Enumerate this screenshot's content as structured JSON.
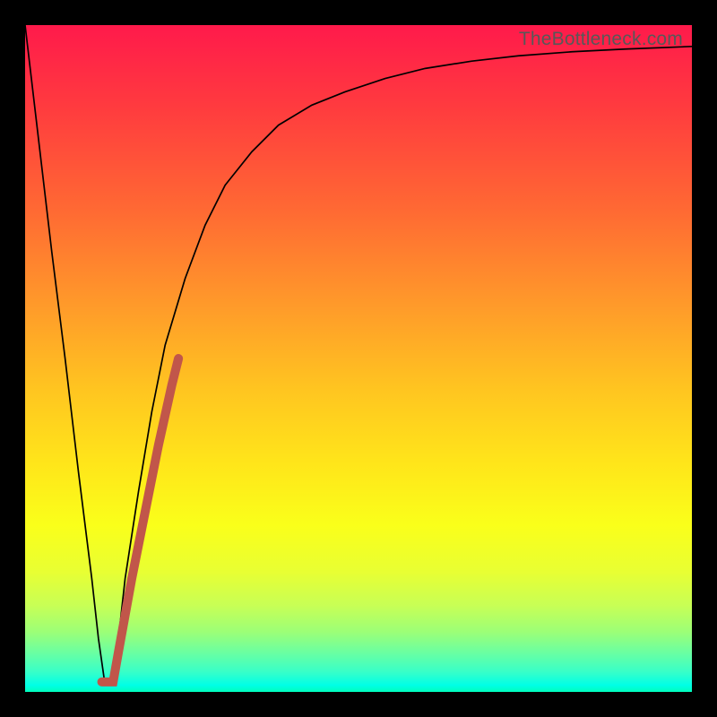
{
  "watermark": "TheBottleneck.com",
  "chart_data": {
    "type": "line",
    "title": "",
    "xlabel": "",
    "ylabel": "",
    "xlim": [
      0,
      100
    ],
    "ylim": [
      0,
      100
    ],
    "grid": false,
    "series": [
      {
        "name": "curve",
        "color": "#000000",
        "stroke_width": 1.7,
        "x": [
          0,
          2,
          4,
          6,
          8,
          10,
          11,
          12,
          13,
          14,
          15,
          17,
          19,
          21,
          24,
          27,
          30,
          34,
          38,
          43,
          48,
          54,
          60,
          67,
          74,
          82,
          90,
          100
        ],
        "y": [
          100,
          83,
          66,
          50,
          33,
          17,
          8,
          1,
          1,
          8,
          17,
          30,
          42,
          52,
          62,
          70,
          76,
          81,
          85,
          88,
          90,
          92,
          93.5,
          94.6,
          95.4,
          96,
          96.4,
          96.8
        ]
      },
      {
        "name": "fit-segment",
        "color": "#c1564a",
        "stroke_width": 10,
        "linecap": "round",
        "x": [
          11.5,
          13.2,
          14.0,
          16.0,
          18.0,
          20.0,
          22.0,
          23.0
        ],
        "y": [
          1.5,
          1.5,
          6.0,
          17.0,
          27.0,
          37.0,
          46.0,
          50.0
        ]
      }
    ],
    "background_gradient": {
      "direction": "vertical",
      "stops": [
        {
          "pos": 0.0,
          "color": "#ff1a4b"
        },
        {
          "pos": 0.12,
          "color": "#ff3a3f"
        },
        {
          "pos": 0.28,
          "color": "#ff6a33"
        },
        {
          "pos": 0.42,
          "color": "#ff9a2a"
        },
        {
          "pos": 0.55,
          "color": "#ffc620"
        },
        {
          "pos": 0.66,
          "color": "#ffe61a"
        },
        {
          "pos": 0.75,
          "color": "#faff1a"
        },
        {
          "pos": 0.82,
          "color": "#e8ff33"
        },
        {
          "pos": 0.87,
          "color": "#c8ff55"
        },
        {
          "pos": 0.91,
          "color": "#9cff77"
        },
        {
          "pos": 0.94,
          "color": "#6cffa0"
        },
        {
          "pos": 0.97,
          "color": "#38ffc8"
        },
        {
          "pos": 0.99,
          "color": "#00ffe6"
        },
        {
          "pos": 1.0,
          "color": "#00ffbb"
        }
      ]
    }
  }
}
